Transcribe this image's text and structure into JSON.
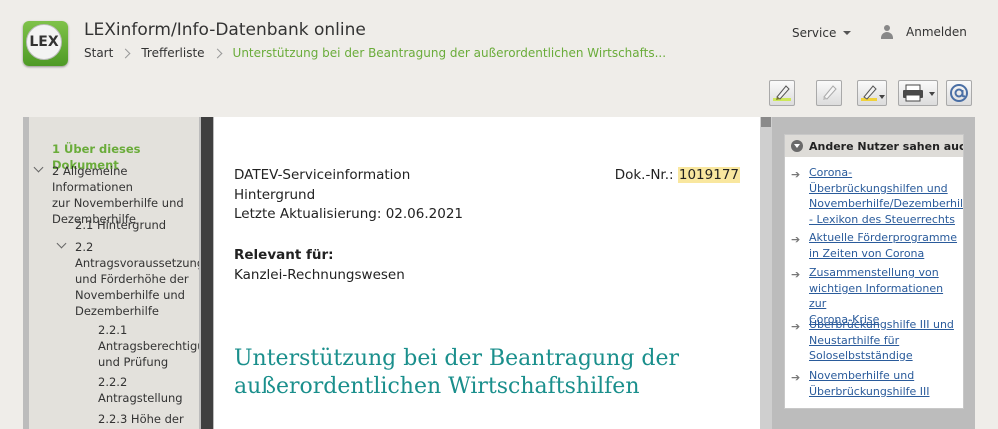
{
  "header": {
    "logo_text": "LEX",
    "app_title": "LEXinform/Info-Datenbank online",
    "breadcrumb": [
      "Start",
      "Trefferliste",
      "Unterstützung bei der Beantragung der außerordentlichen Wirtschafts..."
    ],
    "service_label": "Service",
    "login_label": "Anmelden"
  },
  "toolbar": {
    "icons": [
      "highlight-marker-icon",
      "marker-disabled-icon",
      "marker-dropdown-icon",
      "print-icon",
      "email-icon"
    ]
  },
  "toc": {
    "items": [
      {
        "label": "1 Über dieses Dokument",
        "active": true
      },
      {
        "label": "2 Allgemeine Informationen\nzur Novemberhilfe und\nDezemberhilfe"
      },
      {
        "label": "2.1 Hintergrund"
      },
      {
        "label": "2.2\nAntragsvoraussetzungen\nund Förderhöhe der\nNovemberhilfe und\nDezemberhilfe"
      },
      {
        "label": "2.2.1\nAntragsberechtigung\nund Prüfung"
      },
      {
        "label": "2.2.2\nAntragstellung"
      },
      {
        "label": "2.2.3 Höhe der"
      }
    ]
  },
  "document": {
    "source": "DATEV-Serviceinformation",
    "category": "Hintergrund",
    "updated": "Letzte Aktualisierung: 02.06.2021",
    "doc_nr_label": "Dok.-Nr.:",
    "doc_nr": "1019177",
    "relevant_label": "Relevant für:",
    "relevant_value": "Kanzlei-Rechnungswesen",
    "title": "Unterstützung bei der Beantragung der außerordentlichen Wirtschaftshilfen"
  },
  "side_panel": {
    "heading": "Andere Nutzer sahen auch",
    "links": [
      "Corona-\nÜberbrückungshilfen und\nNovemberhilfe/Dezemberhilfe\n- Lexikon des Steuerrechts",
      "Aktuelle Förderprogramme\nin Zeiten von Corona",
      "Zusammenstellung von\nwichtigen Informationen zur\nCorona-Krise",
      "Überbrückungshilfe III und\nNeustarthilfe für\nSoloselbstständige",
      "Novemberhilfe und\nÜberbrückungshilfe III"
    ]
  },
  "colors": {
    "brand_green": "#6aac3a",
    "title_teal": "#1a8f8c",
    "link_blue": "#2a5b9b",
    "highlight": "#f9e79f"
  }
}
